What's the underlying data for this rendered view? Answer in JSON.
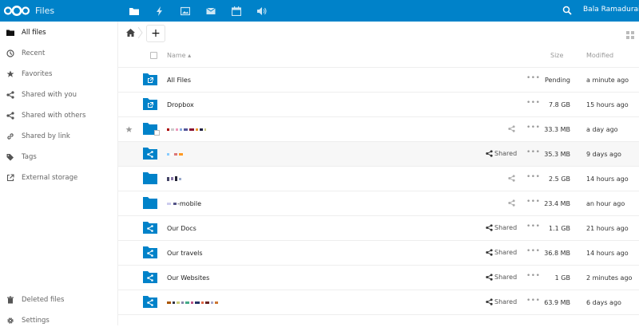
{
  "header": {
    "app_title": "Files",
    "apps": [
      "folder-icon",
      "activity-icon",
      "gallery-icon",
      "mail-icon",
      "calendar-icon",
      "audio-icon"
    ],
    "user_name": "Bala Ramadurai",
    "accent_color": "#0082c9"
  },
  "sidebar": {
    "items": [
      {
        "label": "All files",
        "icon": "folder-icon",
        "active": true
      },
      {
        "label": "Recent",
        "icon": "clock-icon"
      },
      {
        "label": "Favorites",
        "icon": "star-icon"
      },
      {
        "label": "Shared with you",
        "icon": "share-icon"
      },
      {
        "label": "Shared with others",
        "icon": "share-icon"
      },
      {
        "label": "Shared by link",
        "icon": "link-icon"
      },
      {
        "label": "Tags",
        "icon": "tag-icon"
      },
      {
        "label": "External storage",
        "icon": "external-icon"
      }
    ],
    "bottom": [
      {
        "label": "Deleted files",
        "icon": "trash-icon"
      },
      {
        "label": "Settings",
        "icon": "gear-icon"
      }
    ]
  },
  "controls": {
    "new_label": "+"
  },
  "table": {
    "col_name": "Name",
    "col_size": "Size",
    "col_modified": "Modified",
    "rows": [
      {
        "name": "All Files",
        "size": "Pending",
        "modified": "a minute ago",
        "icon": "external-folder-icon",
        "shared": ""
      },
      {
        "name": "Dropbox",
        "size": "7.8 GB",
        "modified": "15 hours ago",
        "icon": "external-folder-icon",
        "shared": ""
      },
      {
        "name": "",
        "size": "33.3 MB",
        "modified": "a day ago",
        "icon": "folder-icon",
        "shared": "icon",
        "starred": true
      },
      {
        "name": "",
        "size": "35.3 MB",
        "modified": "9 days ago",
        "icon": "shared-folder-icon",
        "shared": "Shared"
      },
      {
        "name": "",
        "size": "2.5 GB",
        "modified": "14 hours ago",
        "icon": "folder-icon",
        "shared": "icon"
      },
      {
        "name": "-mobile",
        "size": "23.4 MB",
        "modified": "an hour ago",
        "icon": "folder-icon",
        "shared": "icon"
      },
      {
        "name": "Our Docs",
        "size": "1.1 GB",
        "modified": "21 hours ago",
        "icon": "shared-folder-icon",
        "shared": "Shared"
      },
      {
        "name": "Our travels",
        "size": "36.8 MB",
        "modified": "14 hours ago",
        "icon": "shared-folder-icon",
        "shared": "Shared"
      },
      {
        "name": "Our Websites",
        "size": "1 GB",
        "modified": "2 minutes ago",
        "icon": "shared-folder-icon",
        "shared": "Shared"
      },
      {
        "name": "",
        "size": "63.9 MB",
        "modified": "6 days ago",
        "icon": "shared-folder-icon",
        "shared": "Shared"
      }
    ]
  }
}
